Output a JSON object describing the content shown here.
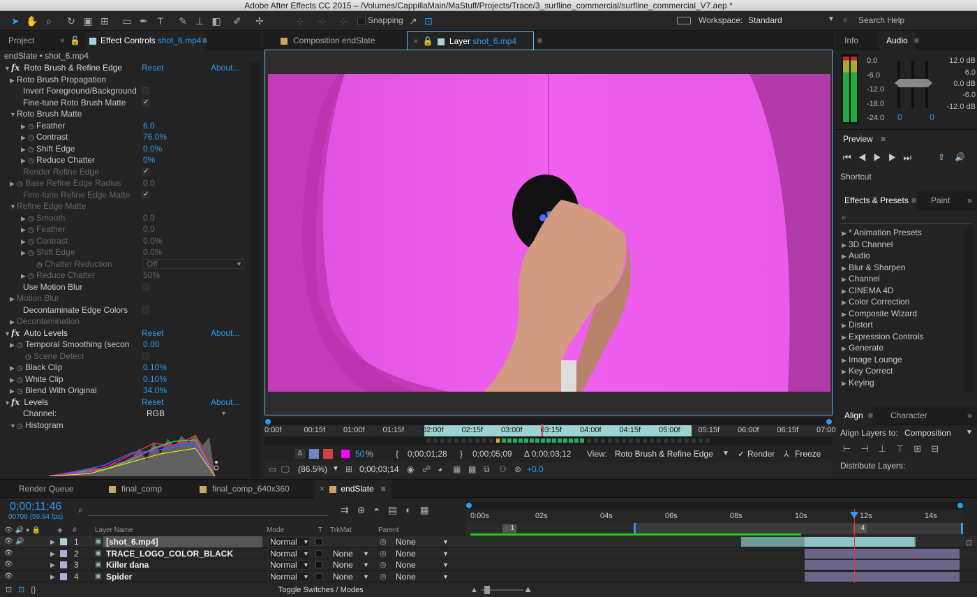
{
  "window": {
    "title": "Adobe After Effects CC 2015 – /Volumes/CappillaMain/MaStuff/Projects/Trace/3_surfline_commercial/surfline_commercial_V7.aep *"
  },
  "toolbar": {
    "snapping": "Snapping",
    "workspace_label": "Workspace:",
    "workspace_value": "Standard",
    "search": "Search Help"
  },
  "left_tabs": {
    "project": "Project",
    "effect_controls": "Effect Controls",
    "effect_layer": "shot_6.mp4"
  },
  "effect_header": "endSlate • shot_6.mp4",
  "effects": [
    {
      "label": "Roto Brush & Refine Edge",
      "kind": "fx",
      "reset": "Reset",
      "about": "About..."
    },
    {
      "label": "Roto Brush Propagation",
      "kind": "group1"
    },
    {
      "label": "Invert Foreground/Background",
      "kind": "check",
      "checked": ""
    },
    {
      "label": "Fine-tune Roto Brush Matte",
      "kind": "check",
      "checked": "✓"
    },
    {
      "label": "Roto Brush Matte",
      "kind": "group1open"
    },
    {
      "label": "Feather",
      "kind": "prop",
      "value": "6.0"
    },
    {
      "label": "Contrast",
      "kind": "prop",
      "value": "76.0%"
    },
    {
      "label": "Shift Edge",
      "kind": "prop",
      "value": "0.0%"
    },
    {
      "label": "Reduce Chatter",
      "kind": "prop",
      "value": "0%"
    },
    {
      "label": "Render Refine Edge",
      "kind": "dimcheck",
      "checked": "✓"
    },
    {
      "label": "Base Refine Edge Radius",
      "kind": "dimprop1",
      "value": "0.0"
    },
    {
      "label": "Fine-tune Refine Edge Matte",
      "kind": "dimcheck",
      "checked": "✓"
    },
    {
      "label": "Refine Edge Matte",
      "kind": "dimgroup"
    },
    {
      "label": "Smooth",
      "kind": "dimprop",
      "value": "0.0"
    },
    {
      "label": "Feather",
      "kind": "dimprop",
      "value": "0.0"
    },
    {
      "label": "Contrast",
      "kind": "dimprop",
      "value": "0.0%"
    },
    {
      "label": "Shift Edge",
      "kind": "dimprop",
      "value": "0.0%"
    },
    {
      "label": "Chatter Reduction",
      "kind": "dimselect",
      "value": "Off"
    },
    {
      "label": "Reduce Chatter",
      "kind": "dimprop",
      "value": "50%"
    },
    {
      "label": "Use Motion Blur",
      "kind": "check",
      "checked": ""
    },
    {
      "label": "Motion Blur",
      "kind": "dimgroup1"
    },
    {
      "label": "Decontaminate Edge Colors",
      "kind": "check",
      "checked": ""
    },
    {
      "label": "Decontamination",
      "kind": "dimgroup1"
    },
    {
      "label": "Auto Levels",
      "kind": "fx",
      "reset": "Reset",
      "about": "About..."
    },
    {
      "label": "Temporal Smoothing (secon",
      "kind": "prop1",
      "value": "0.00"
    },
    {
      "label": "Scene Detect",
      "kind": "dimcheck2",
      "checked": ""
    },
    {
      "label": "Black Clip",
      "kind": "prop1",
      "value": "0.10%"
    },
    {
      "label": "White Clip",
      "kind": "prop1",
      "value": "0.10%"
    },
    {
      "label": "Blend With Original",
      "kind": "prop1",
      "value": "34.0%"
    },
    {
      "label": "Levels",
      "kind": "fx",
      "reset": "Reset",
      "about": "About..."
    },
    {
      "label": "Channel:",
      "kind": "select",
      "value": "RGB"
    },
    {
      "label": "Histogram",
      "kind": "group1open"
    }
  ],
  "viewer_tabs": {
    "comp": "Composition endSlate",
    "layer_prefix": "Layer",
    "layer_name": "shot_6.mp4"
  },
  "ruler": [
    "0:00f",
    "00:15f",
    "01:00f",
    "01:15f",
    "02:00f",
    "02:15f",
    "03:00f",
    "03:15f",
    "04:00f",
    "04:15f",
    "05:00f",
    "05:15f",
    "06:00f",
    "06:15f",
    "07:00f"
  ],
  "viewer_controls": {
    "zoom_pct": "50",
    "pct": "%",
    "in_time": "0;00;01;28",
    "out_time": "0;00;05;09",
    "duration": "Δ 0;00;03;12",
    "view_label": "View:",
    "view_value": "Roto Brush & Refine Edge",
    "render": "Render",
    "freeze": "Freeze",
    "mag": "(86.5%)",
    "current": "0;00;03;14",
    "exposure": "+0.0"
  },
  "right": {
    "info_tab": "Info",
    "audio_tab": "Audio",
    "audio_left": [
      "0.0",
      "-6.0",
      "-12.0",
      "-18.0",
      "-24.0"
    ],
    "audio_right": [
      "12.0 dB",
      "6.0",
      "0.0 dB",
      "-6.0",
      "-12.0 dB"
    ],
    "vol_l": "0",
    "vol_r": "0",
    "preview_tab": "Preview",
    "shortcut": "Shortcut",
    "effects_tab": "Effects & Presets",
    "paint_tab": "Paint",
    "effect_list": [
      "* Animation Presets",
      "3D Channel",
      "Audio",
      "Blur & Sharpen",
      "Channel",
      "CINEMA 4D",
      "Color Correction",
      "Composite Wizard",
      "Distort",
      "Expression Controls",
      "Generate",
      "Image Lounge",
      "Key Correct",
      "Keying"
    ],
    "align_tab": "Align",
    "character_tab": "Character",
    "align_label": "Align Layers to:",
    "align_value": "Composition",
    "distribute": "Distribute Layers:"
  },
  "timeline": {
    "tabs": [
      "Render Queue",
      "final_comp",
      "final_comp_640x360",
      "endSlate"
    ],
    "timecode": "0;00;11;46",
    "frames": "00706 (59.94 fps)",
    "cols": {
      "num": "#",
      "name": "Layer Name",
      "mode": "Mode",
      "t": "T",
      "trk": "TrkMat",
      "parent": "Parent"
    },
    "ruler": [
      "0:00s",
      "02s",
      "04s",
      "06s",
      "08s",
      "10s",
      "12s",
      "14s"
    ],
    "markers": [
      "1",
      "4"
    ],
    "layers": [
      {
        "num": "1",
        "name": "[shot_6.mp4]",
        "mode": "Normal",
        "trk": "",
        "parent": "None"
      },
      {
        "num": "2",
        "name": "TRACE_LOGO_COLOR_BLACK",
        "mode": "Normal",
        "trk": "None",
        "parent": "None"
      },
      {
        "num": "3",
        "name": "Killer dana",
        "mode": "Normal",
        "trk": "None",
        "parent": "None"
      },
      {
        "num": "4",
        "name": "Spider",
        "mode": "Normal",
        "trk": "None",
        "parent": "None"
      }
    ],
    "toggle": "Toggle Switches / Modes"
  },
  "colors": {
    "accent": "#2d9bef",
    "magenta": "#e455e0"
  }
}
